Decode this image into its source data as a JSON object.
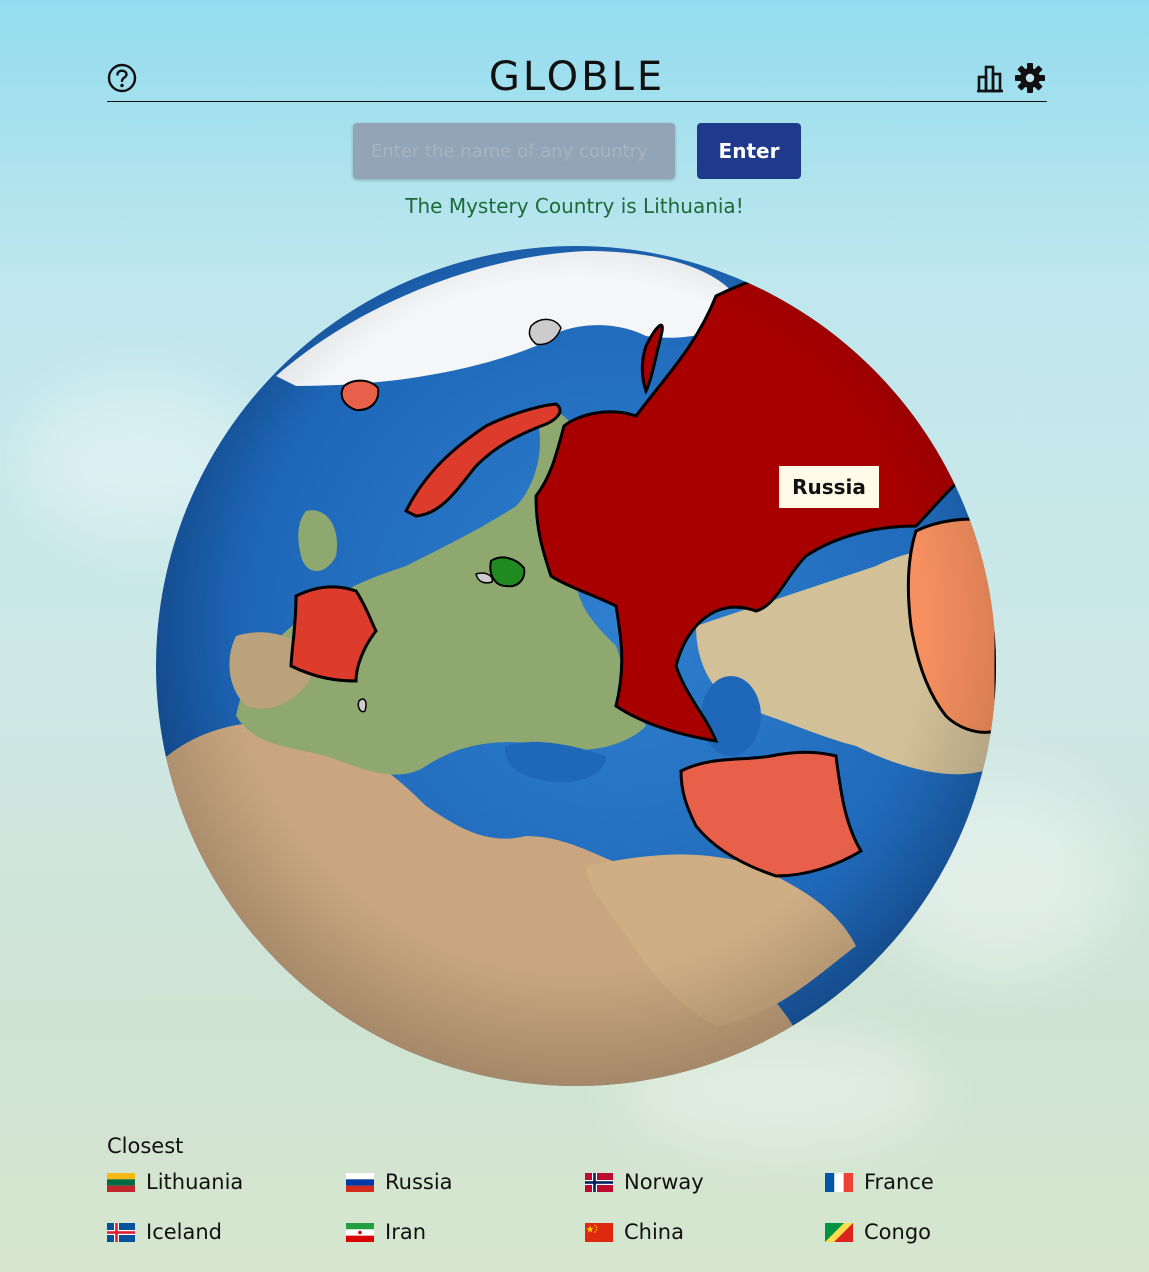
{
  "header": {
    "title": "GLOBLE"
  },
  "search": {
    "placeholder": "Enter the name of any country",
    "value": "",
    "enter_label": "Enter"
  },
  "status": {
    "message": "The Mystery Country is Lithuania!"
  },
  "globe": {
    "tooltip": "Russia"
  },
  "closest": {
    "title": "Closest",
    "guesses": [
      {
        "name": "Lithuania"
      },
      {
        "name": "Russia"
      },
      {
        "name": "Norway"
      },
      {
        "name": "France"
      },
      {
        "name": "Iceland"
      },
      {
        "name": "Iran"
      },
      {
        "name": "China"
      },
      {
        "name": "Congo"
      }
    ]
  },
  "colors": {
    "answer": "#1f8a1f",
    "closest_guess": "#a80000",
    "mid_guess": "#e8604a",
    "far_guess": "#f79060",
    "enter_button": "#1f3a8a",
    "win_text": "#1c6b37"
  }
}
